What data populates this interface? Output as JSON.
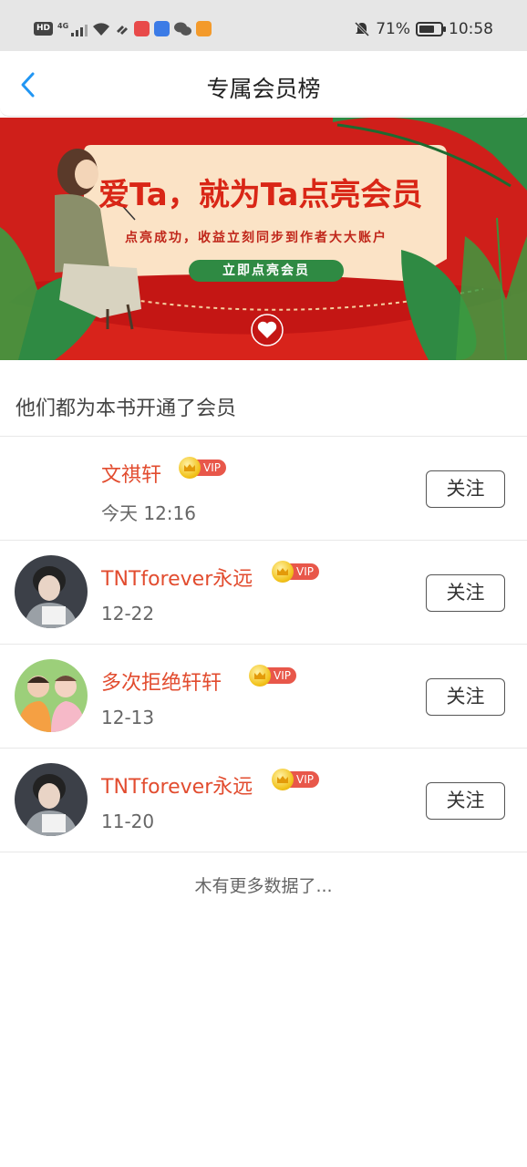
{
  "status_bar": {
    "hd_badge": "HD",
    "network": "4G",
    "battery_percent": "71%",
    "battery_level": 0.71,
    "time": "10:58"
  },
  "nav": {
    "title": "专属会员榜"
  },
  "banner": {
    "title": "爱Ta，就为Ta点亮会员",
    "subtitle": "点亮成功，收益立刻同步到作者大大账户",
    "button_label": "立即点亮会员"
  },
  "section": {
    "title": "他们都为本书开通了会员"
  },
  "members": [
    {
      "name": "文祺轩",
      "vip_label": "VIP",
      "date": "今天 12:16",
      "follow_label": "关注",
      "avatar": "none"
    },
    {
      "name": "TNTforever永远",
      "vip_label": "VIP",
      "date": "12-22",
      "follow_label": "关注",
      "avatar": "photo-boy-grey"
    },
    {
      "name": "多次拒绝轩轩",
      "vip_label": "VIP",
      "date": "12-13",
      "follow_label": "关注",
      "avatar": "photo-two-kids"
    },
    {
      "name": "TNTforever永远",
      "vip_label": "VIP",
      "date": "11-20",
      "follow_label": "关注",
      "avatar": "photo-boy-grey"
    }
  ],
  "footer": {
    "text": "木有更多数据了..."
  },
  "colors": {
    "accent_blue": "#2196f3",
    "banner_red": "#cf1f1a",
    "name_red": "#e24c2f",
    "vip_red": "#e8574a"
  }
}
